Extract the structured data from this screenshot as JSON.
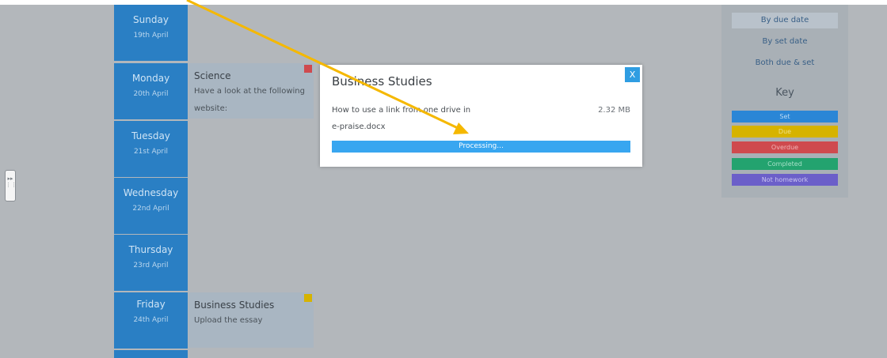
{
  "days": [
    {
      "name": "Sunday",
      "date": "19th April"
    },
    {
      "name": "Monday",
      "date": "20th April"
    },
    {
      "name": "Tuesday",
      "date": "21st April"
    },
    {
      "name": "Wednesday",
      "date": "22nd April"
    },
    {
      "name": "Thursday",
      "date": "23rd April"
    },
    {
      "name": "Friday",
      "date": "24th April"
    }
  ],
  "cards": {
    "monday": {
      "title": "Science",
      "description": "Have a look at the following website:",
      "status": "Overdue"
    },
    "friday": {
      "title": "Business Studies",
      "description": "Upload the essay",
      "status": "Due"
    }
  },
  "sidebar": {
    "sort_due": "By due date",
    "sort_set": "By set date",
    "sort_both": "Both due & set",
    "key_title": "Key",
    "key": [
      {
        "label": "Set",
        "color": "#2a86d6",
        "text_color": "#bcdaf3"
      },
      {
        "label": "Due",
        "color": "#d6b300",
        "text_color": "#f0e08a"
      },
      {
        "label": "Overdue",
        "color": "#cf4a4e",
        "text_color": "#f1b5b6"
      },
      {
        "label": "Completed",
        "color": "#23a36f",
        "text_color": "#a7e0c8"
      },
      {
        "label": "Not homework",
        "color": "#6b5fc9",
        "text_color": "#cbc5f0"
      }
    ]
  },
  "modal": {
    "title": "Business Studies",
    "close_label": "X",
    "file_name_line1": "How to use a link from one drive in",
    "file_name_line2": "e-praise.docx",
    "file_size": "2.32 MB",
    "progress_label": "Processing...",
    "progress_fraction": 1.0
  },
  "colors": {
    "day_bg": "#2a7fc4",
    "accent": "#2f9de2",
    "annotation_arrow": "#f5b800"
  }
}
